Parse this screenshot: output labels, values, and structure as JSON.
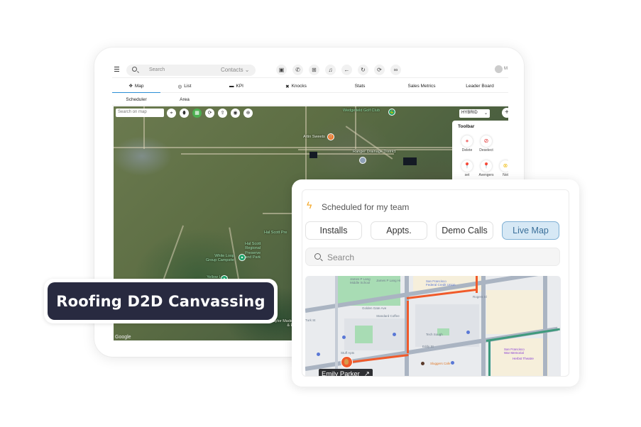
{
  "app": {
    "search_placeholder": "Search",
    "search_scope": "Contacts ⌄",
    "header_icons": [
      {
        "name": "message-icon",
        "glyph": "▣"
      },
      {
        "name": "phone-icon",
        "glyph": "✆"
      },
      {
        "name": "plus-square-icon",
        "glyph": "⊞"
      },
      {
        "name": "bell-icon",
        "glyph": "♫"
      },
      {
        "name": "arrow-left-icon",
        "glyph": "←"
      },
      {
        "name": "refresh-pin-icon",
        "glyph": "↻"
      },
      {
        "name": "sync-icon",
        "glyph": "⟳"
      },
      {
        "name": "glasses-icon",
        "glyph": "∞"
      }
    ],
    "avatar_initial": "M",
    "tabs": [
      {
        "label": "Map",
        "icon": "✥",
        "active": true
      },
      {
        "label": "List",
        "icon": "◎",
        "active": false
      },
      {
        "label": "KPI",
        "icon": "▬",
        "active": false
      },
      {
        "label": "Knocks",
        "icon": "✖",
        "active": false
      },
      {
        "label": "Stats",
        "icon": "",
        "active": false
      },
      {
        "label": "Sales Metrics",
        "icon": "",
        "active": false
      },
      {
        "label": "Leader Board",
        "icon": "",
        "active": false
      }
    ],
    "subtabs": [
      {
        "label": "Scheduler"
      },
      {
        "label": "Area"
      }
    ]
  },
  "map": {
    "search_placeholder": "Search on map",
    "tools": [
      {
        "name": "locate-icon",
        "glyph": "⌖"
      },
      {
        "name": "pin-icon",
        "glyph": "⬮"
      },
      {
        "name": "map-layers-icon",
        "glyph": "▦"
      },
      {
        "name": "refresh-icon",
        "glyph": "⟳"
      },
      {
        "name": "upload-icon",
        "glyph": "⇪"
      },
      {
        "name": "eye-icon",
        "glyph": "◉"
      },
      {
        "name": "globe-icon",
        "glyph": "⊕"
      }
    ],
    "map_type": "HYBRID",
    "zoom_in": "+",
    "toolbar": {
      "title": "Toolbar",
      "buttons": [
        {
          "label": "Delete",
          "glyph": "●",
          "color": "#f07a7a"
        },
        {
          "label": "Deselect",
          "glyph": "⊘",
          "color": "#e03030"
        },
        {
          "label": "set",
          "glyph": "⬤",
          "color": "#111111"
        },
        {
          "label": "Avengers",
          "glyph": "⬤",
          "color": "#111111"
        },
        {
          "label": "Not",
          "glyph": "⊗",
          "color": "#f0c020"
        }
      ]
    },
    "labels": {
      "golf_club": "Wedgefield Golf Club",
      "artin_sweets": "Artin Sweets",
      "ranger_district": "Ranger Drainage District",
      "hal_scott_1": "Hal Scott Pre",
      "hal_scott_2": "Hal Scott\nRegional\nPreserve\nand Park",
      "white_loop": "White Loop\nGroup Campsite",
      "yellow_loop": "Yellow Loop\nCampground South",
      "taylor_made": "Taylor Made G\n& Em",
      "google": "Google"
    }
  },
  "badge": {
    "text": "Roofing D2D Canvassing"
  },
  "scheduler": {
    "title": "Scheduled for my team",
    "chips": [
      {
        "label": "Installs",
        "active": false
      },
      {
        "label": "Appts.",
        "active": false
      },
      {
        "label": "Demo Calls",
        "active": false
      },
      {
        "label": "Live Map",
        "active": true
      }
    ],
    "search_placeholder": "Search",
    "map_labels": {
      "james_lick_1": "James P Lang\nMiddle School",
      "james_lick_2": "James P Lang Hi",
      "sf_federal": "San Francisco\nFederal Credit Union",
      "golden_gate": "Golden Gate Ave",
      "standard_coffee": "Standard Coffee",
      "tenth_rogers": "Rogers Sl",
      "turk_st": "Turk St",
      "eddy": "Eddy St",
      "tsq_sough": "Tech Sough",
      "stuff": "Stuff Apts",
      "sf_war": "San Francisco\nWar Memorial",
      "herbst": "Herbst Theatre",
      "sloppy_joe": "Sluggers Cafe"
    },
    "person": {
      "name": "Emily Parker",
      "open_icon": "↗"
    },
    "colors": {
      "route": "#f05a2a",
      "route_secondary": "#3f9a7d",
      "accent": "#f5a623",
      "active_chip": "#d6e8f5"
    }
  }
}
